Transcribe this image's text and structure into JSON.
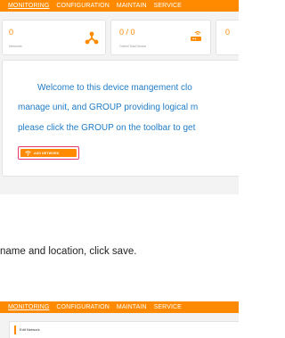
{
  "nav": {
    "items": [
      "MONITORING",
      "CONFIGURATION",
      "MAINTAIN",
      "SERVICE"
    ]
  },
  "stats": [
    {
      "value": "0",
      "label": "Networks",
      "icon": "network-topology-icon"
    },
    {
      "value": "0 / 0",
      "label": "Online/Total Device",
      "icon": "router-icon"
    },
    {
      "value": "0",
      "label": "",
      "icon": ""
    }
  ],
  "welcome": {
    "line1": "Welcome to this device mangement clo",
    "line2": "manage unit, and GROUP providing logical m",
    "line3": "please click the GROUP on the toolbar to get"
  },
  "add_network": {
    "label": "ADD NETWORK",
    "icon": "wifi-icon"
  },
  "caption": "name and location, click save.",
  "panel2": {
    "title": "Edit Network"
  },
  "colors": {
    "accent": "#ff8a00",
    "welcome_text": "#1f7cc7",
    "highlight": "#e23b6c"
  }
}
